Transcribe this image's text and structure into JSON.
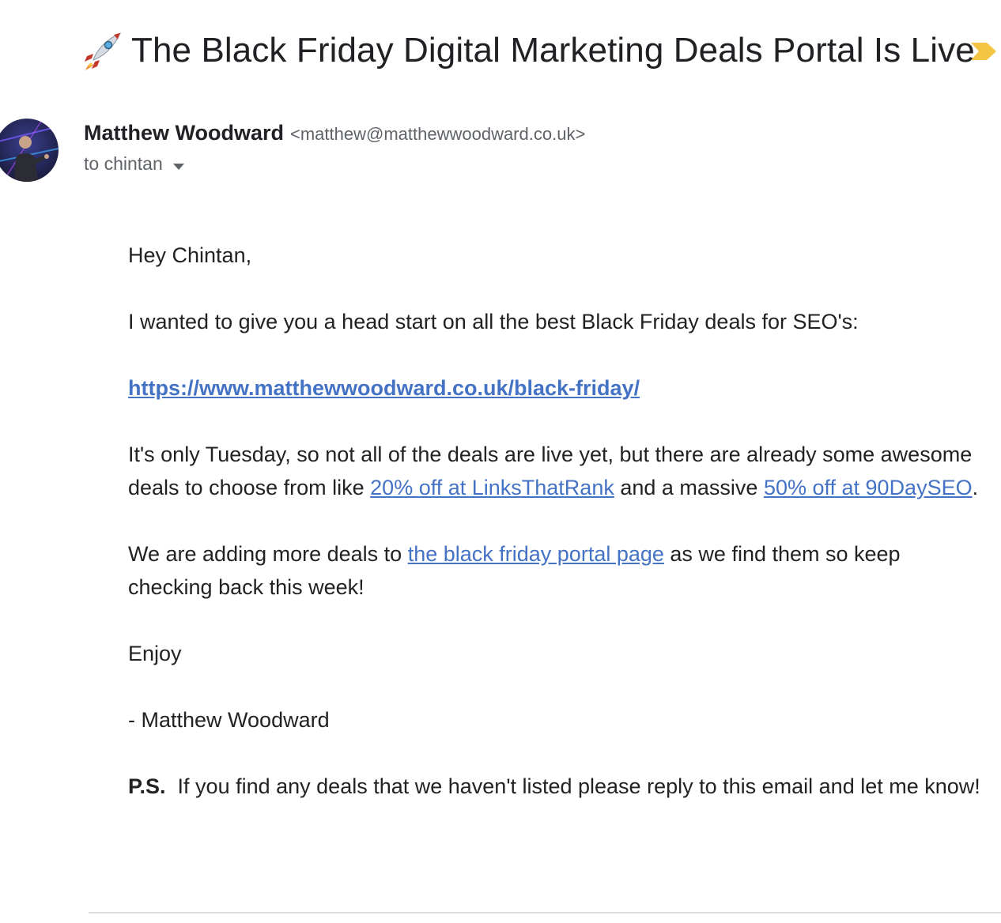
{
  "email": {
    "subject": "The Black Friday Digital Marketing Deals Portal Is Live",
    "subject_emoji_icon": "rocket-icon",
    "important_marker_icon": "important-marker-icon",
    "important_marker_color": "#f4c542",
    "sender_name": "Matthew Woodward",
    "sender_email": "<matthew@matthewwoodward.co.uk>",
    "recipient": "to chintan",
    "body": {
      "greeting": "Hey Chintan,",
      "intro": "I wanted to give you a head start on all the best Black Friday deals for SEO's:",
      "main_link": "https://www.matthewwoodward.co.uk/black-friday/",
      "p3_before": "It's only Tuesday, so not all of the deals are live yet, but there are already some awesome deals to choose from like ",
      "p3_link1": "20% off at LinksThatRank",
      "p3_middle": " and a massive ",
      "p3_link2": "50% off at 90DaySEO",
      "p3_after": ".",
      "p4_before": "We are adding more deals to ",
      "p4_link": "the black friday portal page",
      "p4_after": " as we find them so keep checking back this week!",
      "sign_off": "Enjoy",
      "signature": "- Matthew Woodward",
      "ps_label": "P.S.",
      "ps_text": "  If you find any deals that we haven't listed please reply to this email and let me know!"
    },
    "colors": {
      "link": "#4472c4",
      "text": "#222222",
      "secondary_text": "#5f6368"
    }
  }
}
